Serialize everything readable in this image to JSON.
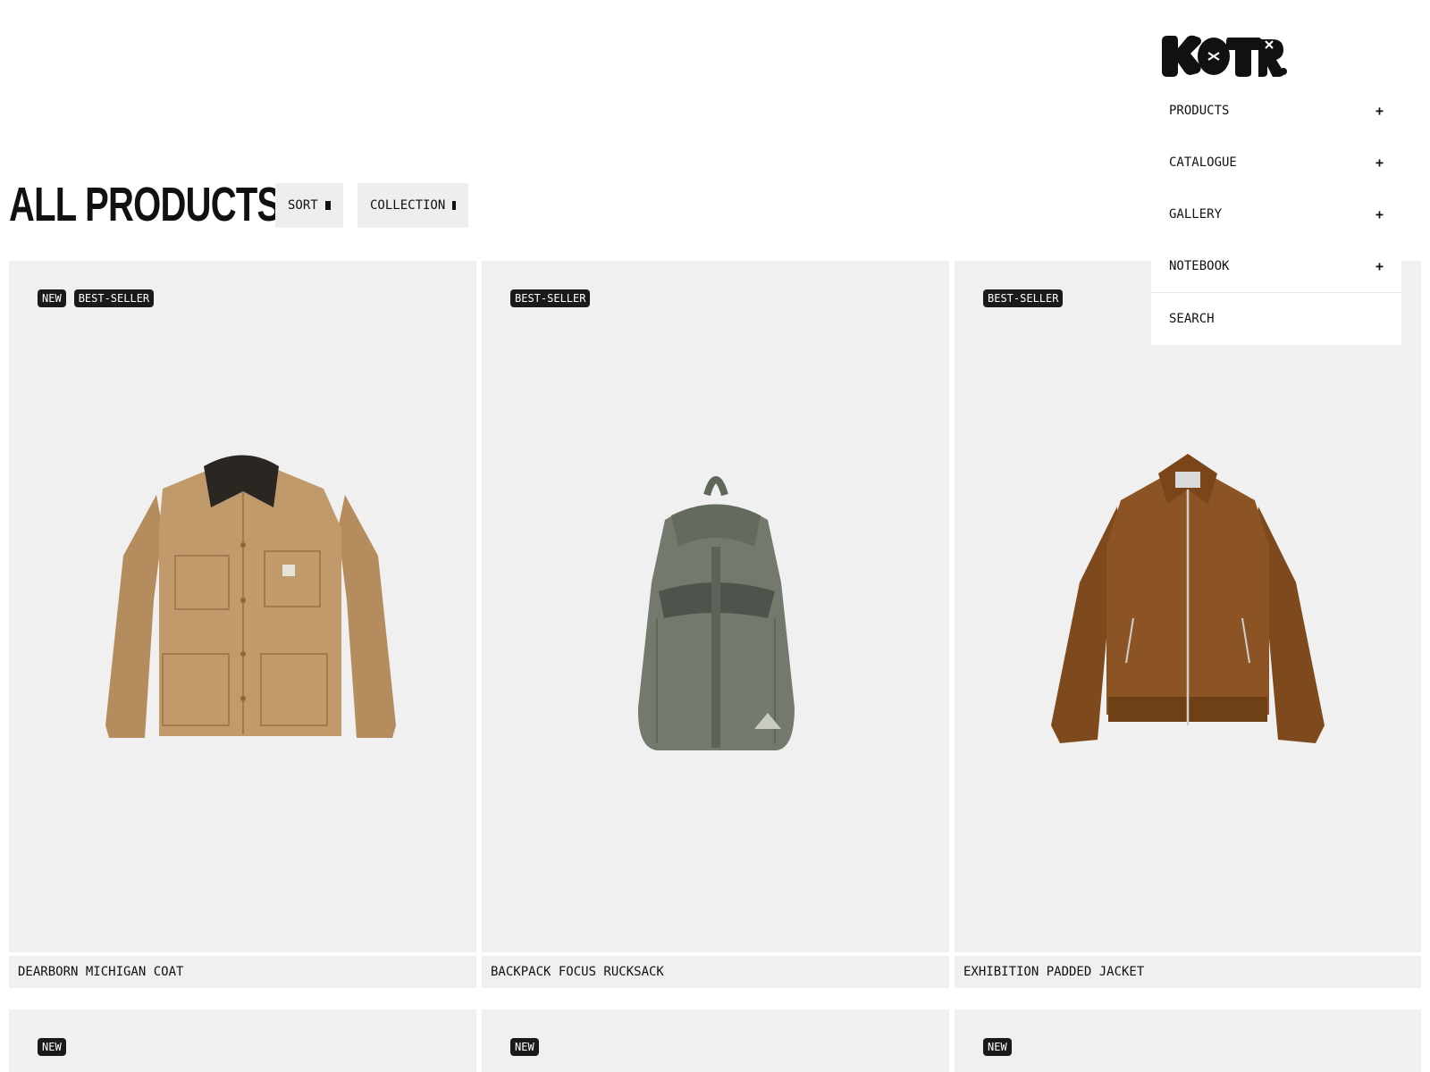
{
  "brand": {
    "logo_text": "KOTR."
  },
  "nav": {
    "items": [
      {
        "label": "PRODUCTS",
        "expand": "+"
      },
      {
        "label": "CATALOGUE",
        "expand": "+"
      },
      {
        "label": "GALLERY",
        "expand": "+"
      },
      {
        "label": "NOTEBOOK",
        "expand": "+"
      }
    ],
    "search_label": "SEARCH"
  },
  "page": {
    "title": "ALL PRODUCTS"
  },
  "filters": {
    "sort_label": "SORT",
    "collection_label": "COLLECTION"
  },
  "products": [
    {
      "name": "DEARBORN MICHIGAN COAT",
      "badges": [
        "NEW",
        "BEST-SELLER"
      ],
      "image": "tan canvas chore coat with dark corduroy collar"
    },
    {
      "name": "BACKPACK FOCUS RUCKSACK",
      "badges": [
        "BEST-SELLER"
      ],
      "image": "olive green drawstring rucksack"
    },
    {
      "name": "EXHIBITION PADDED JACKET",
      "badges": [
        "BEST-SELLER"
      ],
      "image": "brown corduroy zip jacket"
    },
    {
      "name": "",
      "badges": [
        "NEW"
      ]
    },
    {
      "name": "",
      "badges": [
        "NEW"
      ]
    },
    {
      "name": "",
      "badges": [
        "NEW"
      ]
    }
  ],
  "colors": {
    "card_bg": "#f0f0f0",
    "badge_bg": "#1a1a1a",
    "text": "#111111"
  }
}
